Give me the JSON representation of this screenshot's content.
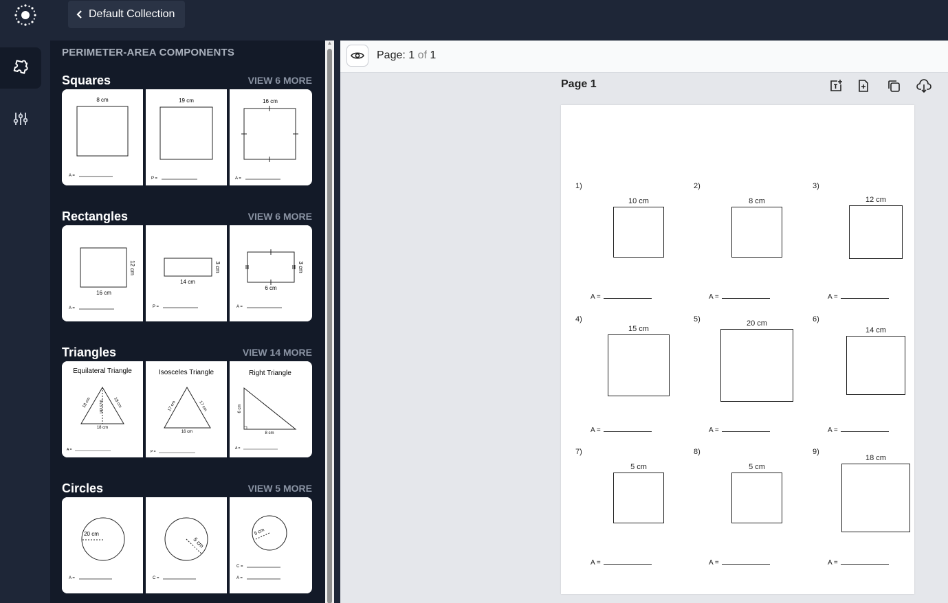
{
  "header": {
    "back_label": "Default Collection"
  },
  "panel": {
    "title": "PERIMETER-AREA COMPONENTS",
    "sections": [
      {
        "title": "Squares",
        "more": "VIEW 6 MORE",
        "cards": [
          {
            "dim": "8 cm",
            "ans": "A ="
          },
          {
            "dim": "19 cm",
            "ans": "P ="
          },
          {
            "dim": "16 cm",
            "ans": "A ="
          }
        ]
      },
      {
        "title": "Rectangles",
        "more": "VIEW 6 MORE",
        "cards": [
          {
            "w": "16 cm",
            "h": "12 cm",
            "ans": "A ="
          },
          {
            "w": "14 cm",
            "h": "3 cm",
            "ans": "P ="
          },
          {
            "w": "6 cm",
            "h": "3 cm",
            "ans": "A ="
          }
        ]
      },
      {
        "title": "Triangles",
        "more": "VIEW 14 MORE",
        "cards": [
          {
            "label": "Equilateral Triangle",
            "a": "18 cm",
            "b": "18 cm",
            "base": "18 cm",
            "hgt": "9√3 cm",
            "ans": "A ="
          },
          {
            "label": "Isosceles Triangle",
            "a": "17 cm",
            "b": "17 cm",
            "base": "16 cm",
            "ans": "P ="
          },
          {
            "label": "Right Triangle",
            "h": "6 cm",
            "base": "8 cm",
            "ans": "A ="
          }
        ]
      },
      {
        "title": "Circles",
        "more": "VIEW 5 MORE",
        "cards": [
          {
            "r": "20 cm",
            "ans": "A ="
          },
          {
            "r": "5 cm",
            "ans": "C ="
          },
          {
            "r": "5 cm",
            "ans1": "C =",
            "ans2": "A ="
          }
        ]
      }
    ]
  },
  "toolbar": {
    "page_label": "Page:",
    "page_current": "1",
    "page_of": "of",
    "page_total": "1"
  },
  "page": {
    "title": "Page 1",
    "problems": [
      {
        "num": "1)",
        "dim": "10 cm",
        "ans": "A ="
      },
      {
        "num": "2)",
        "dim": "8 cm",
        "ans": "A ="
      },
      {
        "num": "3)",
        "dim": "12 cm",
        "ans": "A ="
      },
      {
        "num": "4)",
        "dim": "15 cm",
        "ans": "A ="
      },
      {
        "num": "5)",
        "dim": "20 cm",
        "ans": "A ="
      },
      {
        "num": "6)",
        "dim": "14 cm",
        "ans": "A ="
      },
      {
        "num": "7)",
        "dim": "5 cm",
        "ans": "A ="
      },
      {
        "num": "8)",
        "dim": "5 cm",
        "ans": "A ="
      },
      {
        "num": "9)",
        "dim": "18 cm",
        "ans": "A ="
      }
    ]
  },
  "icons": {
    "logo": "sun-logo-icon",
    "back": "chevron-left-icon",
    "components": "puzzle-icon",
    "settings": "sliders-icon",
    "preview": "eye-icon",
    "add_text": "add-text-icon",
    "add_page": "add-page-icon",
    "duplicate": "duplicate-icon",
    "download": "download-icon",
    "collapse": "chevron-left-icon"
  }
}
